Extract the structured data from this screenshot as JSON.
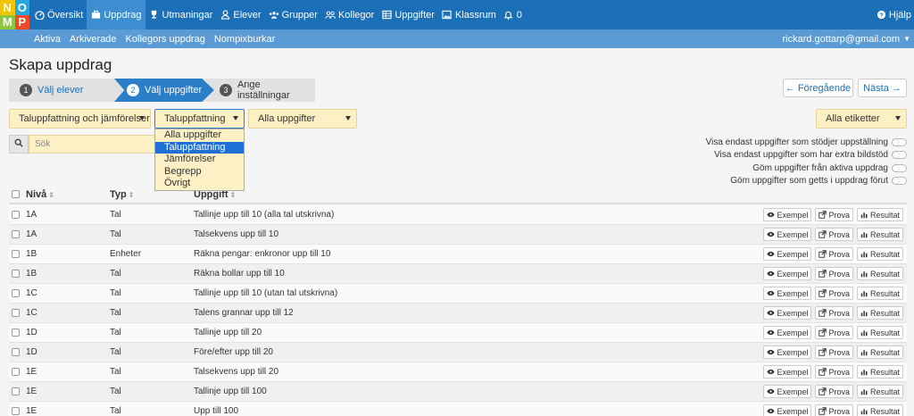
{
  "logo": {
    "letters": [
      "N",
      "O",
      "M",
      "P"
    ]
  },
  "nav": {
    "items": [
      {
        "label": "Översikt",
        "icon": "dashboard-icon"
      },
      {
        "label": "Uppdrag",
        "icon": "briefcase-icon",
        "active": true
      },
      {
        "label": "Utmaningar",
        "icon": "trophy-icon"
      },
      {
        "label": "Elever",
        "icon": "user-icon"
      },
      {
        "label": "Grupper",
        "icon": "group-icon"
      },
      {
        "label": "Kollegor",
        "icon": "users-icon"
      },
      {
        "label": "Uppgifter",
        "icon": "table-icon"
      },
      {
        "label": "Klassrum",
        "icon": "picture-icon"
      },
      {
        "label": "0",
        "icon": "bell-icon"
      }
    ],
    "help_label": "Hjälp"
  },
  "subnav": {
    "links": [
      "Aktiva",
      "Arkiverade",
      "Kollegors uppdrag",
      "Nompixburkar"
    ],
    "user": "rickard.gottarp@gmail.com"
  },
  "page_title": "Skapa uppdrag",
  "wizard": {
    "steps": [
      {
        "num": "1",
        "label": "Välj elever"
      },
      {
        "num": "2",
        "label": "Välj uppgifter"
      },
      {
        "num": "3",
        "label": "Ange inställningar"
      }
    ]
  },
  "pager": {
    "prev": "← Föregående",
    "next": "Nästa →"
  },
  "filters": {
    "area": "Taluppfattning och jämförelser",
    "category": "Taluppfattning",
    "tasks": "Alla uppgifter",
    "labels": "Alla etiketter",
    "search_placeholder": "Sök",
    "category_options": [
      "Alla uppgifter",
      "Taluppfattning",
      "Jämförelser",
      "Begrepp",
      "Övrigt"
    ],
    "category_selected_index": 1
  },
  "toggles": [
    "Visa endast uppgifter som stödjer uppställning",
    "Visa endast uppgifter som har extra bildstöd",
    "Göm uppgifter från aktiva uppdrag",
    "Göm uppgifter som getts i uppdrag förut"
  ],
  "table": {
    "headers": {
      "niva": "Nivå",
      "typ": "Typ",
      "uppgift": "Uppgift"
    },
    "actions": {
      "exempel": "Exempel",
      "prova": "Prova",
      "resultat": "Resultat"
    },
    "rows": [
      {
        "niva": "1A",
        "typ": "Tal",
        "uppgift": "Tallinje upp till 10 (alla tal utskrivna)"
      },
      {
        "niva": "1A",
        "typ": "Tal",
        "uppgift": "Talsekvens upp till 10"
      },
      {
        "niva": "1B",
        "typ": "Enheter",
        "uppgift": "Räkna pengar: enkronor upp till 10"
      },
      {
        "niva": "1B",
        "typ": "Tal",
        "uppgift": "Räkna bollar upp till 10"
      },
      {
        "niva": "1C",
        "typ": "Tal",
        "uppgift": "Tallinje upp till 10 (utan tal utskrivna)"
      },
      {
        "niva": "1C",
        "typ": "Tal",
        "uppgift": "Talens grannar upp till 12"
      },
      {
        "niva": "1D",
        "typ": "Tal",
        "uppgift": "Tallinje upp till 20"
      },
      {
        "niva": "1D",
        "typ": "Tal",
        "uppgift": "Före/efter upp till 20"
      },
      {
        "niva": "1E",
        "typ": "Tal",
        "uppgift": "Talsekvens upp till 20"
      },
      {
        "niva": "1E",
        "typ": "Tal",
        "uppgift": "Tallinje upp till 100"
      },
      {
        "niva": "1E",
        "typ": "Tal",
        "uppgift": "Upp till 100"
      }
    ]
  }
}
